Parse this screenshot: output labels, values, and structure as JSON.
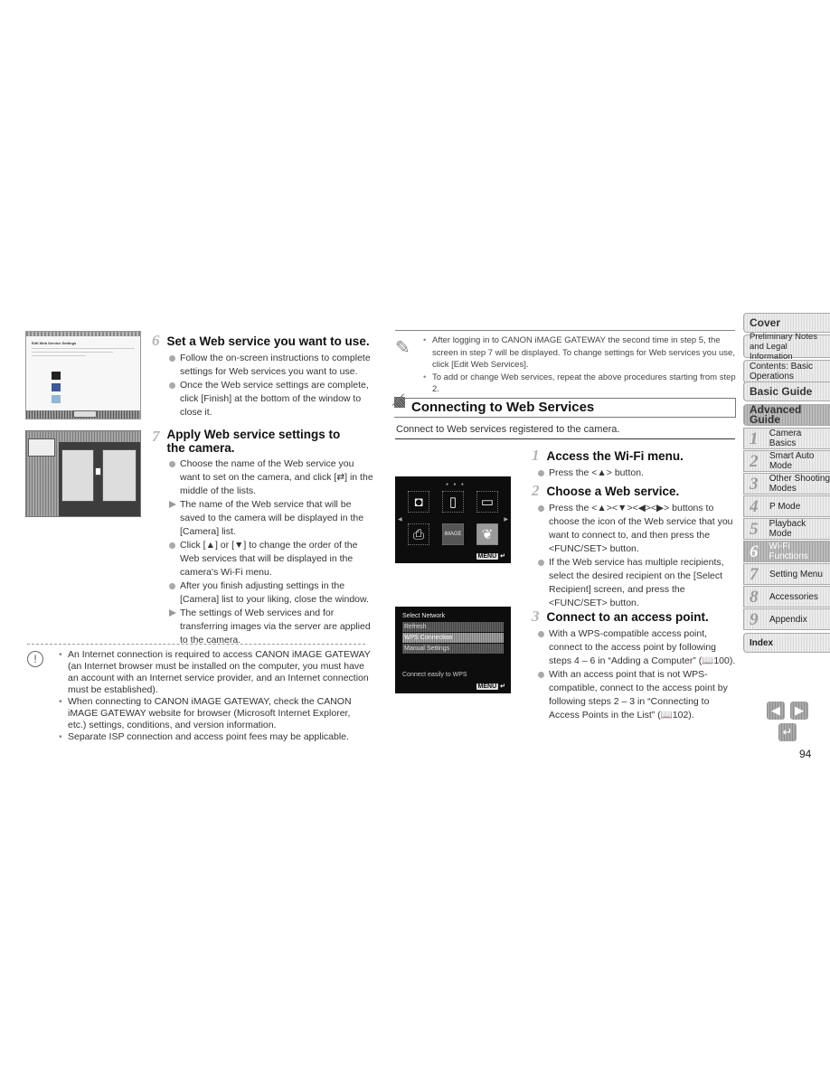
{
  "left_column": {
    "step6": {
      "number": "6",
      "title": "Set a Web service you want to use.",
      "items": [
        {
          "type": "bullet",
          "text": "Follow the on-screen instructions to complete settings for Web services you want to use."
        },
        {
          "type": "bullet",
          "text": "Once the Web service settings are complete, click [Finish] at the bottom of the window to close it."
        }
      ]
    },
    "step7": {
      "number": "7",
      "title_line1": "Apply Web service settings to",
      "title_line2": "the camera.",
      "items": [
        {
          "type": "bullet",
          "text": "Choose the name of the Web service you want to set on the camera, and click [⇄] in the middle of the lists."
        },
        {
          "type": "arrow",
          "text": "The name of the Web service that will be saved to the camera will be displayed in the [Camera] list."
        },
        {
          "type": "bullet",
          "text": "Click [▲] or [▼] to change the order of the Web services that will be displayed in the camera's Wi-Fi menu."
        },
        {
          "type": "bullet",
          "text": "After you finish adjusting settings in the [Camera] list to your liking, close the window."
        },
        {
          "type": "arrow",
          "text": "The settings of Web services and for transferring images via the server are applied to the camera."
        }
      ]
    },
    "screenshot1": {
      "title": "Edit Web Service Settings"
    },
    "caution": {
      "icon": "caution-icon",
      "items": [
        "An Internet connection is required to access CANON iMAGE GATEWAY (an Internet browser must be installed on the computer, you must have an account with an Internet service provider, and an Internet connection must be established).",
        "When connecting to CANON iMAGE GATEWAY, check the CANON iMAGE GATEWAY website for browser (Microsoft Internet Explorer, etc.) settings, conditions, and version information.",
        "Separate ISP connection and access point fees may be applicable."
      ]
    }
  },
  "right_column": {
    "note": {
      "icon": "pencil-icon",
      "items": [
        "After logging in to CANON iMAGE GATEWAY the second time in step 5, the screen in step 7 will be displayed. To change settings for Web services you use, click [Edit Web Services].",
        "To add or change Web services, repeat the above procedures starting from step 2."
      ]
    },
    "section_title": "Connecting to Web Services",
    "section_intro": "Connect to Web services registered to the camera.",
    "step1": {
      "number": "1",
      "title": "Access the Wi-Fi menu.",
      "items": [
        {
          "type": "bullet",
          "text": "Press the <▲> button."
        }
      ]
    },
    "step2": {
      "number": "2",
      "title": "Choose a Web service.",
      "items": [
        {
          "type": "bullet",
          "text": "Press the <▲><▼><◀><▶> buttons to choose the icon of the Web service that you want to connect to, and then press the <FUNC/SET> button."
        },
        {
          "type": "bullet",
          "text": "If the Web service has multiple recipients, select the desired recipient on the [Select Recipient] screen, and press the <FUNC/SET> button."
        }
      ]
    },
    "step3": {
      "number": "3",
      "title": "Connect to an access point.",
      "items": [
        {
          "type": "bullet",
          "text": "With a WPS-compatible access point, connect to the access point by following steps 4 – 6 in “Adding a Computer” (📖100)."
        },
        {
          "type": "bullet",
          "text": "With an access point that is not WPS-compatible, connect to the access point by following steps 2 – 3 in “Connecting to Access Points in the List” (📖102)."
        }
      ]
    },
    "camera_screen1": {
      "icons": [
        "camera-icon",
        "smartphone-icon",
        "computer-icon",
        "printer-icon",
        "canon-image-gateway-icon",
        "twitter-icon"
      ],
      "icon_glyphs": [
        "◘",
        "▯",
        "▭",
        "⎙",
        "iMAGE",
        "❦"
      ],
      "menu_label": "MENU",
      "back_glyph": "↵"
    },
    "camera_screen2": {
      "heading": "Select Network",
      "options": [
        "Refresh",
        "WPS Connection",
        "Manual Settings"
      ],
      "selected": "WPS Connection",
      "hint": "Connect easily to WPS",
      "menu_label": "MENU",
      "back_glyph": "↵"
    }
  },
  "sidebar": {
    "items": [
      {
        "label": "Cover",
        "num": ""
      },
      {
        "label": "Preliminary Notes and Legal Information",
        "num": ""
      },
      {
        "label": "Contents: Basic Operations",
        "num": ""
      },
      {
        "label": "Basic Guide",
        "num": ""
      },
      {
        "label": "Advanced Guide",
        "num": ""
      },
      {
        "label": "Camera Basics",
        "num": "1"
      },
      {
        "label": "Smart Auto Mode",
        "num": "2"
      },
      {
        "label": "Other Shooting Modes",
        "num": "3"
      },
      {
        "label": "P Mode",
        "num": "4"
      },
      {
        "label": "Playback Mode",
        "num": "5"
      },
      {
        "label": "Wi-Fi Functions",
        "num": "6"
      },
      {
        "label": "Setting Menu",
        "num": "7"
      },
      {
        "label": "Accessories",
        "num": "8"
      },
      {
        "label": "Appendix",
        "num": "9"
      },
      {
        "label": "Index",
        "num": ""
      }
    ],
    "active": "Wi-Fi Functions",
    "nav": {
      "prev": "◀",
      "next": "▶",
      "back": "↵"
    }
  },
  "page_number": "94"
}
